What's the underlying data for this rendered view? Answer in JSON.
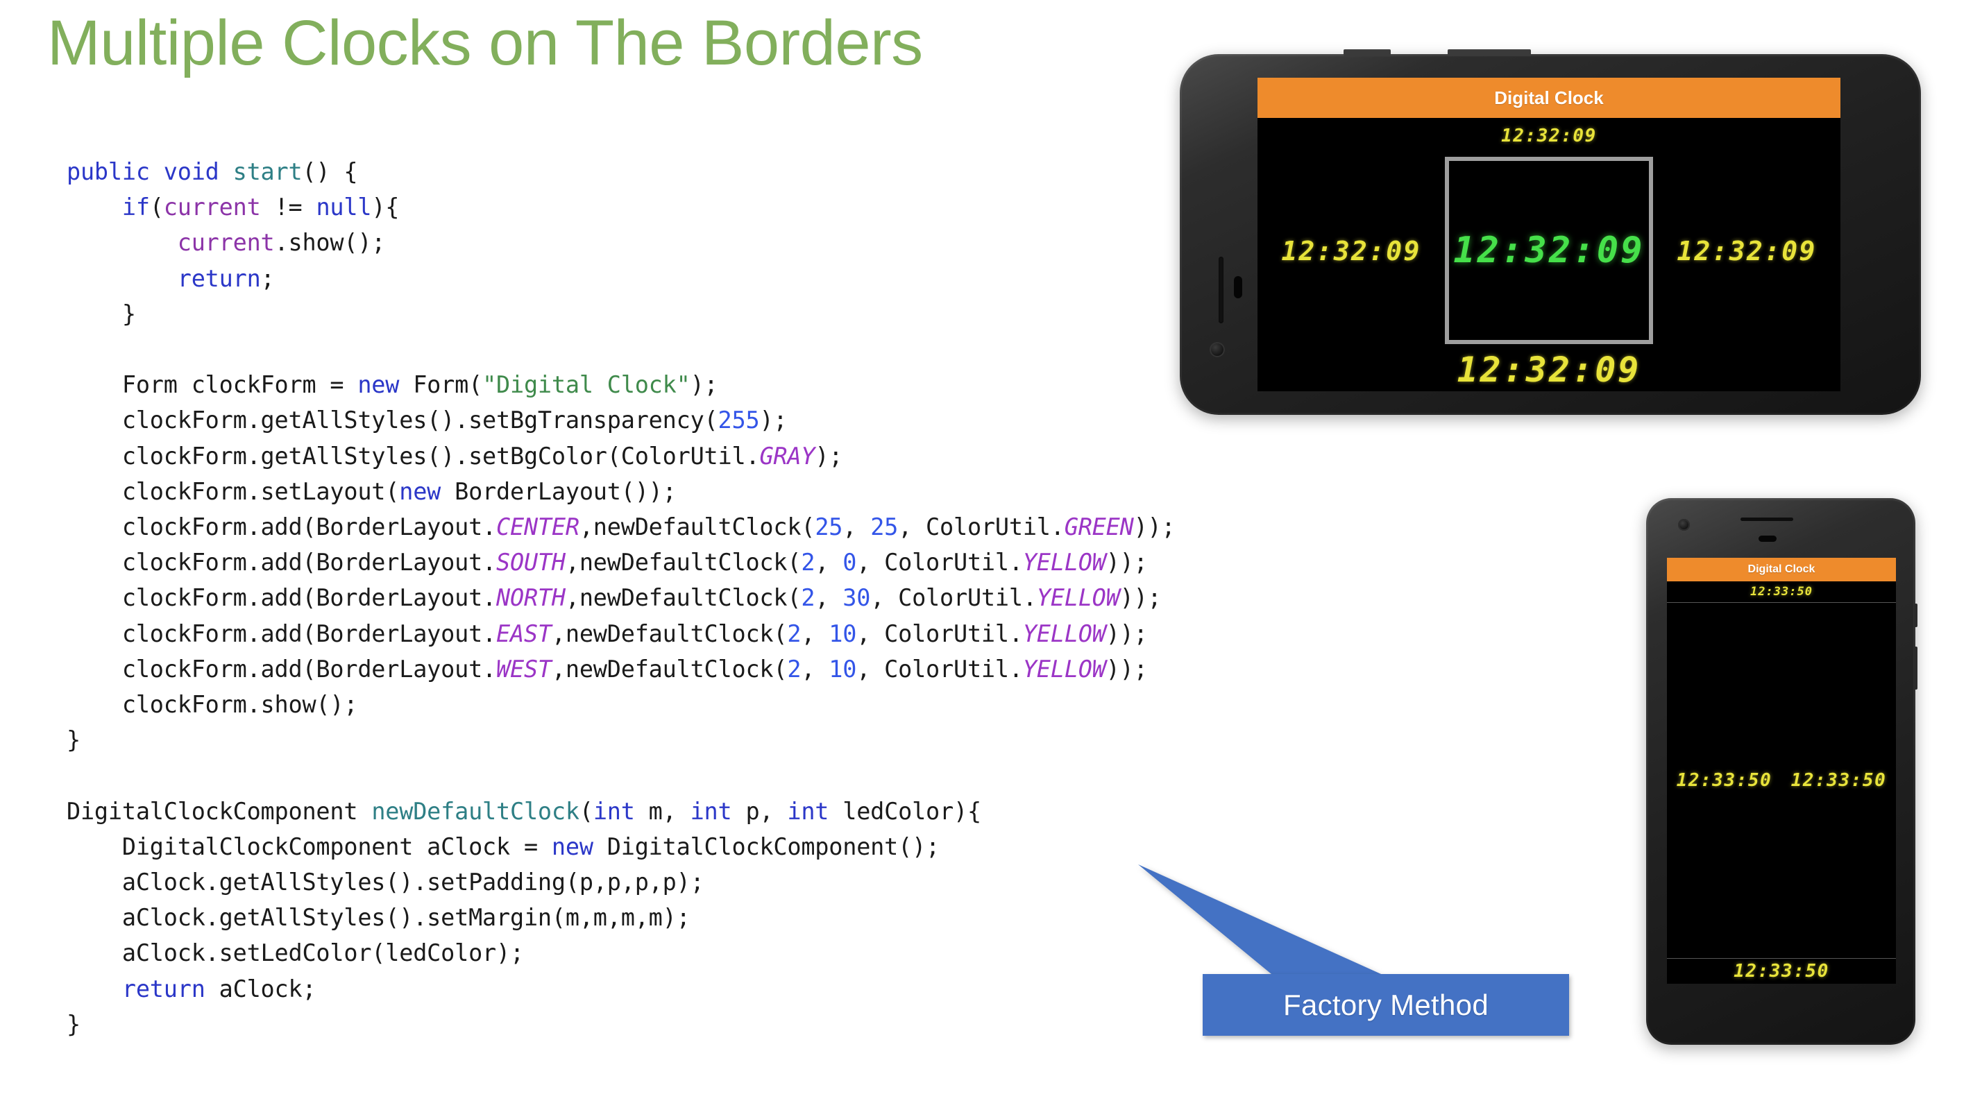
{
  "slide": {
    "title": "Multiple Clocks on The Borders",
    "title_color": "#82AF5C",
    "background_color": "#FFFFFF"
  },
  "code": {
    "language": "java",
    "font": "monospace",
    "syntax_colors": {
      "keyword": "#2B37C8",
      "method": "#2E7F85",
      "field": "#8C34A8",
      "constant": "#9B35C6",
      "string": "#3F8A4B",
      "number": "#3355E8",
      "plain": "#1A1A1A"
    },
    "lines": [
      {
        "tokens": [
          {
            "t": "public",
            "c": "kw"
          },
          {
            "t": " ",
            "c": "plain"
          },
          {
            "t": "void",
            "c": "kw"
          },
          {
            "t": " ",
            "c": "plain"
          },
          {
            "t": "start",
            "c": "method"
          },
          {
            "t": "() {",
            "c": "plain"
          }
        ]
      },
      {
        "tokens": [
          {
            "t": "    ",
            "c": "plain"
          },
          {
            "t": "if",
            "c": "kw"
          },
          {
            "t": "(",
            "c": "plain"
          },
          {
            "t": "current",
            "c": "field"
          },
          {
            "t": " != ",
            "c": "plain"
          },
          {
            "t": "null",
            "c": "kw"
          },
          {
            "t": "){",
            "c": "plain"
          }
        ]
      },
      {
        "tokens": [
          {
            "t": "        ",
            "c": "plain"
          },
          {
            "t": "current",
            "c": "field"
          },
          {
            "t": ".show();",
            "c": "plain"
          }
        ]
      },
      {
        "tokens": [
          {
            "t": "        ",
            "c": "plain"
          },
          {
            "t": "return",
            "c": "kw"
          },
          {
            "t": ";",
            "c": "plain"
          }
        ]
      },
      {
        "tokens": [
          {
            "t": "    }",
            "c": "plain"
          }
        ]
      },
      {
        "tokens": []
      },
      {
        "tokens": [
          {
            "t": "    Form clockForm = ",
            "c": "plain"
          },
          {
            "t": "new",
            "c": "kw"
          },
          {
            "t": " Form(",
            "c": "plain"
          },
          {
            "t": "\"Digital Clock\"",
            "c": "str"
          },
          {
            "t": ");",
            "c": "plain"
          }
        ]
      },
      {
        "tokens": [
          {
            "t": "    clockForm.getAllStyles().setBgTransparency(",
            "c": "plain"
          },
          {
            "t": "255",
            "c": "num"
          },
          {
            "t": ");",
            "c": "plain"
          }
        ]
      },
      {
        "tokens": [
          {
            "t": "    clockForm.getAllStyles().setBgColor(ColorUtil.",
            "c": "plain"
          },
          {
            "t": "GRAY",
            "c": "const"
          },
          {
            "t": ");",
            "c": "plain"
          }
        ]
      },
      {
        "tokens": [
          {
            "t": "    clockForm.setLayout(",
            "c": "plain"
          },
          {
            "t": "new",
            "c": "kw"
          },
          {
            "t": " BorderLayout());",
            "c": "plain"
          }
        ]
      },
      {
        "tokens": [
          {
            "t": "    clockForm.add(BorderLayout.",
            "c": "plain"
          },
          {
            "t": "CENTER",
            "c": "const"
          },
          {
            "t": ",newDefaultClock(",
            "c": "plain"
          },
          {
            "t": "25",
            "c": "num"
          },
          {
            "t": ", ",
            "c": "plain"
          },
          {
            "t": "25",
            "c": "num"
          },
          {
            "t": ", ColorUtil.",
            "c": "plain"
          },
          {
            "t": "GREEN",
            "c": "const"
          },
          {
            "t": "));",
            "c": "plain"
          }
        ]
      },
      {
        "tokens": [
          {
            "t": "    clockForm.add(BorderLayout.",
            "c": "plain"
          },
          {
            "t": "SOUTH",
            "c": "const"
          },
          {
            "t": ",newDefaultClock(",
            "c": "plain"
          },
          {
            "t": "2",
            "c": "num"
          },
          {
            "t": ", ",
            "c": "plain"
          },
          {
            "t": "0",
            "c": "num"
          },
          {
            "t": ", ColorUtil.",
            "c": "plain"
          },
          {
            "t": "YELLOW",
            "c": "const"
          },
          {
            "t": "));",
            "c": "plain"
          }
        ]
      },
      {
        "tokens": [
          {
            "t": "    clockForm.add(BorderLayout.",
            "c": "plain"
          },
          {
            "t": "NORTH",
            "c": "const"
          },
          {
            "t": ",newDefaultClock(",
            "c": "plain"
          },
          {
            "t": "2",
            "c": "num"
          },
          {
            "t": ", ",
            "c": "plain"
          },
          {
            "t": "30",
            "c": "num"
          },
          {
            "t": ", ColorUtil.",
            "c": "plain"
          },
          {
            "t": "YELLOW",
            "c": "const"
          },
          {
            "t": "));",
            "c": "plain"
          }
        ]
      },
      {
        "tokens": [
          {
            "t": "    clockForm.add(BorderLayout.",
            "c": "plain"
          },
          {
            "t": "EAST",
            "c": "const"
          },
          {
            "t": ",newDefaultClock(",
            "c": "plain"
          },
          {
            "t": "2",
            "c": "num"
          },
          {
            "t": ", ",
            "c": "plain"
          },
          {
            "t": "10",
            "c": "num"
          },
          {
            "t": ", ColorUtil.",
            "c": "plain"
          },
          {
            "t": "YELLOW",
            "c": "const"
          },
          {
            "t": "));",
            "c": "plain"
          }
        ]
      },
      {
        "tokens": [
          {
            "t": "    clockForm.add(BorderLayout.",
            "c": "plain"
          },
          {
            "t": "WEST",
            "c": "const"
          },
          {
            "t": ",newDefaultClock(",
            "c": "plain"
          },
          {
            "t": "2",
            "c": "num"
          },
          {
            "t": ", ",
            "c": "plain"
          },
          {
            "t": "10",
            "c": "num"
          },
          {
            "t": ", ColorUtil.",
            "c": "plain"
          },
          {
            "t": "YELLOW",
            "c": "const"
          },
          {
            "t": "));",
            "c": "plain"
          }
        ]
      },
      {
        "tokens": [
          {
            "t": "    clockForm.show();",
            "c": "plain"
          }
        ]
      },
      {
        "tokens": [
          {
            "t": "}",
            "c": "plain"
          }
        ]
      },
      {
        "tokens": []
      },
      {
        "tokens": [
          {
            "t": "DigitalClockComponent ",
            "c": "plain"
          },
          {
            "t": "newDefaultClock",
            "c": "method"
          },
          {
            "t": "(",
            "c": "plain"
          },
          {
            "t": "int",
            "c": "kw"
          },
          {
            "t": " m, ",
            "c": "plain"
          },
          {
            "t": "int",
            "c": "kw"
          },
          {
            "t": " p, ",
            "c": "plain"
          },
          {
            "t": "int",
            "c": "kw"
          },
          {
            "t": " ledColor){",
            "c": "plain"
          }
        ]
      },
      {
        "tokens": [
          {
            "t": "    DigitalClockComponent aClock = ",
            "c": "plain"
          },
          {
            "t": "new",
            "c": "kw"
          },
          {
            "t": " DigitalClockComponent();",
            "c": "plain"
          }
        ]
      },
      {
        "tokens": [
          {
            "t": "    aClock.getAllStyles().setPadding(p,p,p,p);",
            "c": "plain"
          }
        ]
      },
      {
        "tokens": [
          {
            "t": "    aClock.getAllStyles().setMargin(m,m,m,m);",
            "c": "plain"
          }
        ]
      },
      {
        "tokens": [
          {
            "t": "    aClock.setLedColor(ledColor);",
            "c": "plain"
          }
        ]
      },
      {
        "tokens": [
          {
            "t": "    ",
            "c": "plain"
          },
          {
            "t": "return",
            "c": "kw"
          },
          {
            "t": " aClock;",
            "c": "plain"
          }
        ]
      },
      {
        "tokens": [
          {
            "t": "}",
            "c": "plain"
          }
        ]
      }
    ]
  },
  "phone_landscape": {
    "orientation": "landscape",
    "app_title": "Digital Clock",
    "title_bar_color": "#EE8B2C",
    "screen_background": "#000000",
    "center_border_color": "#9E9E9E",
    "clocks": {
      "north": {
        "time": "12:32:09",
        "color": "#E8E33A",
        "color_name": "YELLOW"
      },
      "west": {
        "time": "12:32:09",
        "color": "#E8E33A",
        "color_name": "YELLOW"
      },
      "center": {
        "time": "12:32:09",
        "color": "#46E04A",
        "color_name": "GREEN"
      },
      "east": {
        "time": "12:32:09",
        "color": "#E8E33A",
        "color_name": "YELLOW"
      },
      "south": {
        "time": "12:32:09",
        "color": "#E8E33A",
        "color_name": "YELLOW"
      }
    }
  },
  "phone_portrait": {
    "orientation": "portrait",
    "app_title": "Digital Clock",
    "title_bar_color": "#EE8B2C",
    "screen_background": "#000000",
    "clocks": {
      "north": {
        "time": "12:33:50",
        "color": "#E8E33A",
        "color_name": "YELLOW"
      },
      "west": {
        "time": "12:33:50",
        "color": "#E8E33A",
        "color_name": "YELLOW"
      },
      "east": {
        "time": "12:33:50",
        "color": "#E8E33A",
        "color_name": "YELLOW"
      },
      "south": {
        "time": "12:33:50",
        "color": "#E8E33A",
        "color_name": "YELLOW"
      }
    }
  },
  "callout": {
    "label": "Factory Method",
    "fill_color": "#4472C4",
    "text_color": "#FFFFFF"
  }
}
